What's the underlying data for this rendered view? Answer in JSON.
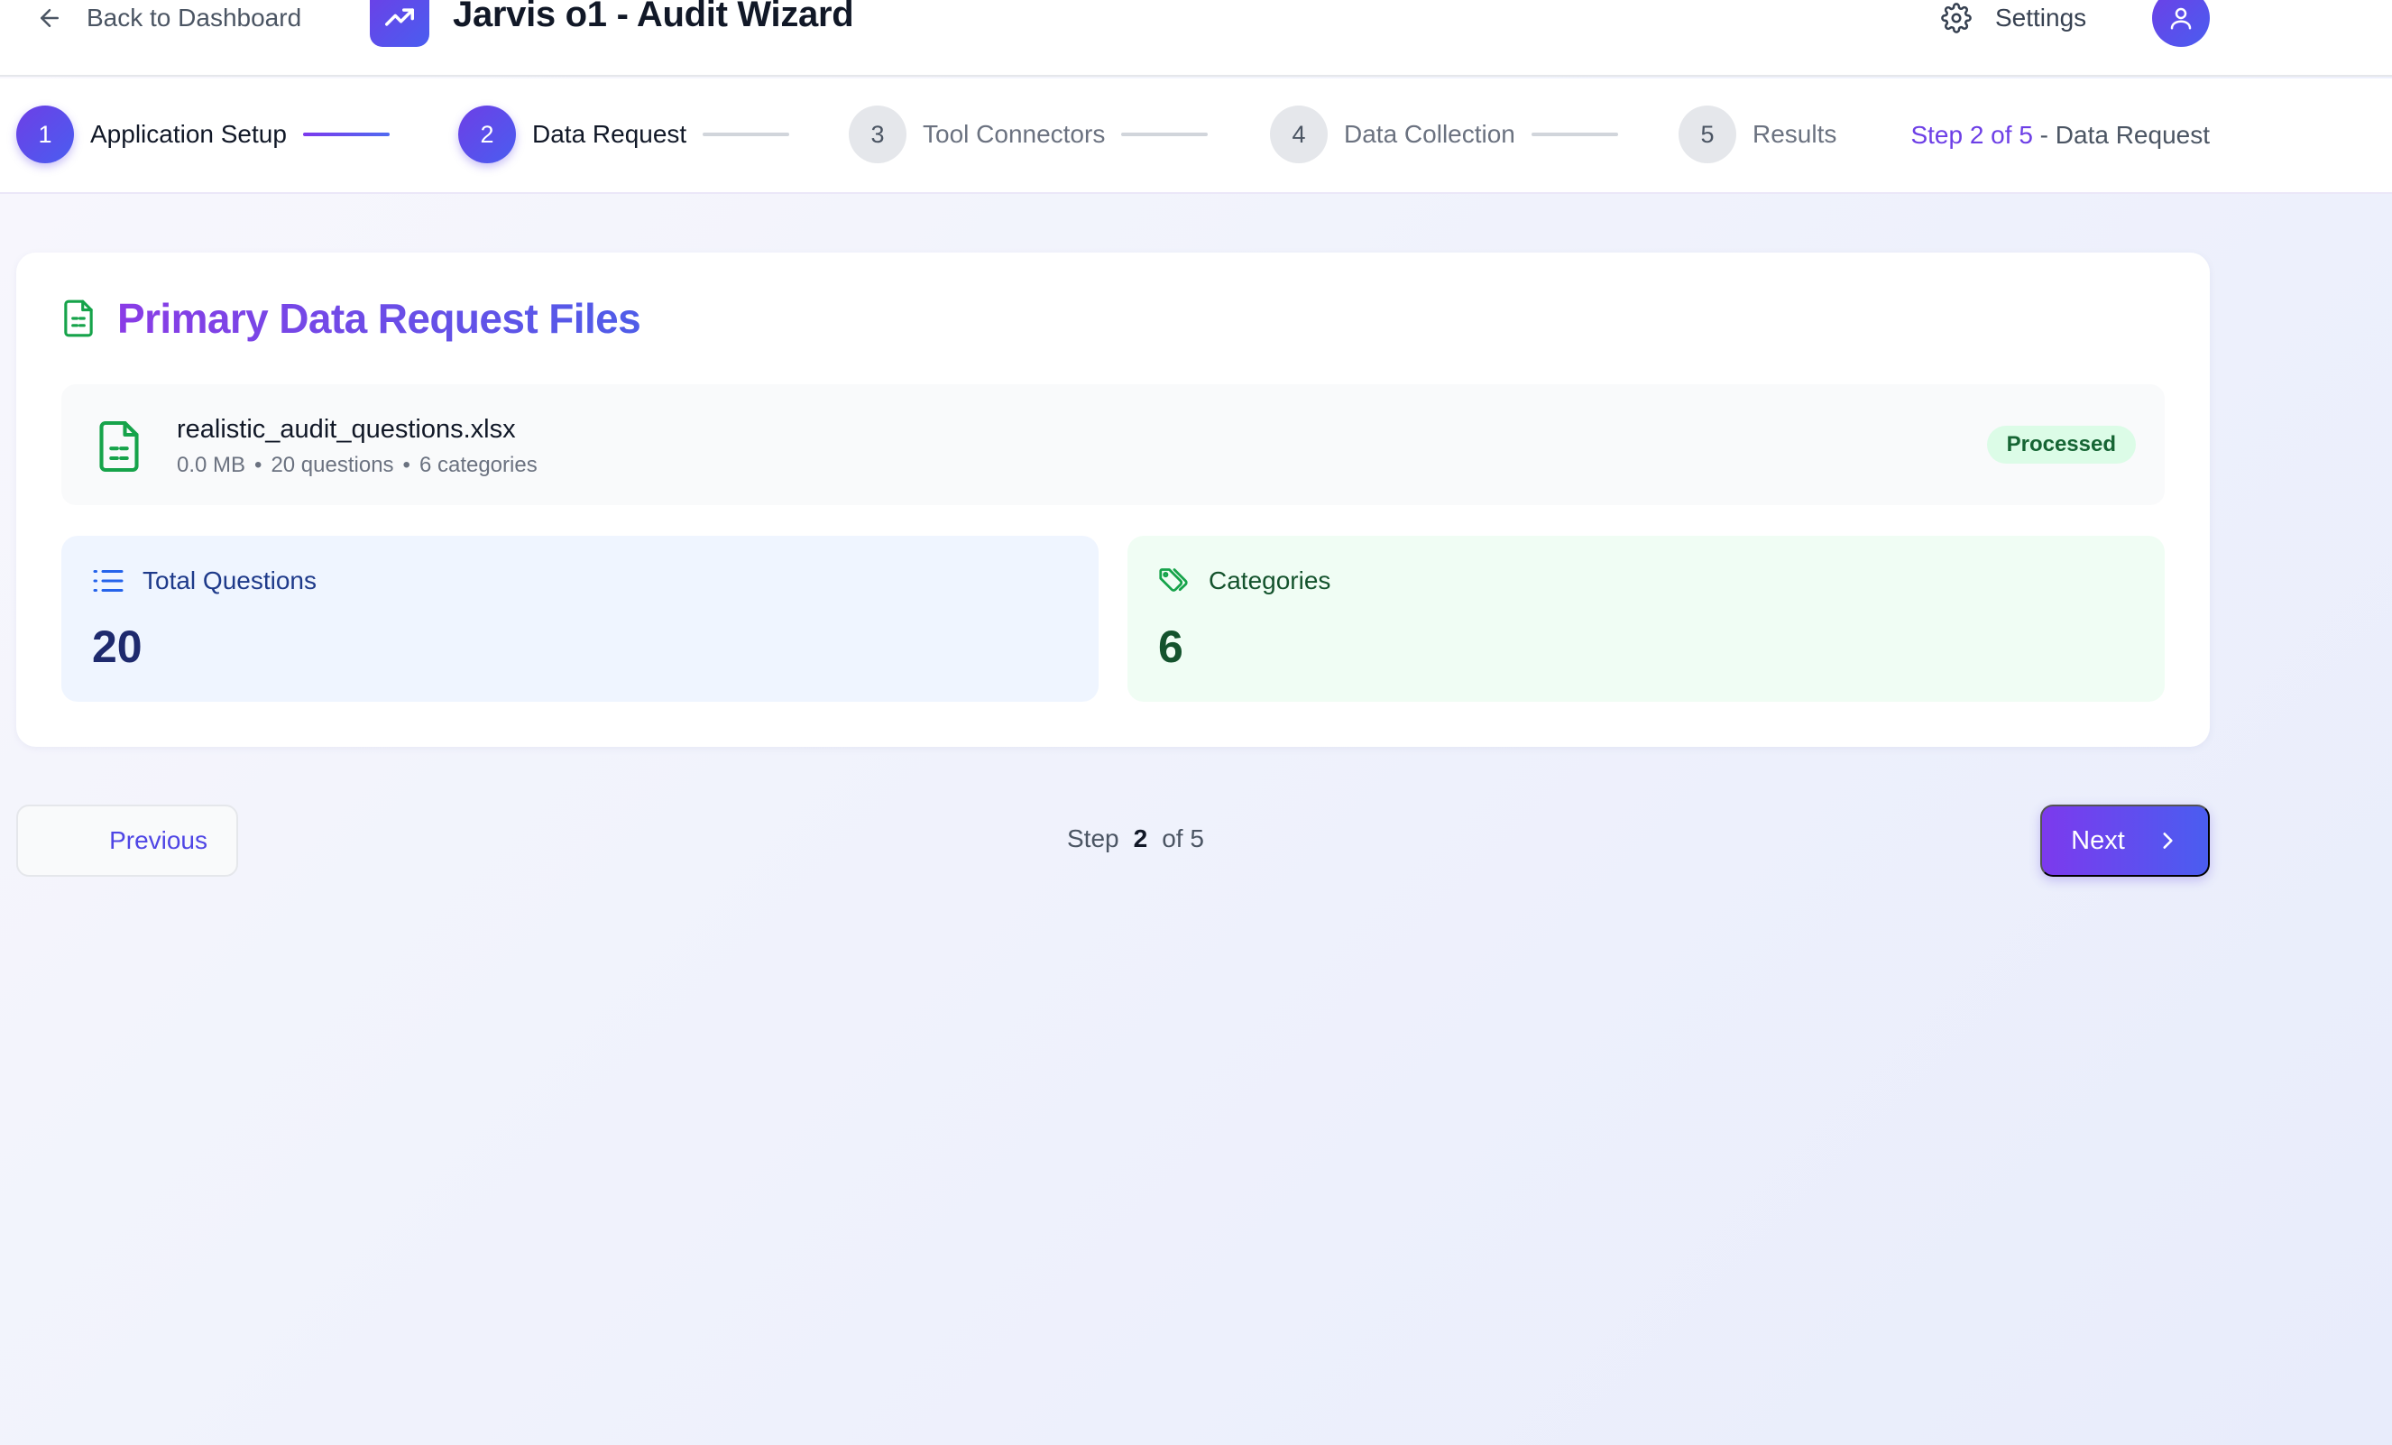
{
  "header": {
    "back_label": "Back to Dashboard",
    "title": "Jarvis o1 - Audit Wizard",
    "settings_label": "Settings"
  },
  "stepper": {
    "steps": [
      {
        "number": "1",
        "label": "Application Setup",
        "state": "completed"
      },
      {
        "number": "2",
        "label": "Data Request",
        "state": "current"
      },
      {
        "number": "3",
        "label": "Tool Connectors",
        "state": "upcoming"
      },
      {
        "number": "4",
        "label": "Data Collection",
        "state": "upcoming"
      },
      {
        "number": "5",
        "label": "Results",
        "state": "upcoming"
      }
    ],
    "status_accent": "Step 2 of 5",
    "status_rest": " - Data Request"
  },
  "card": {
    "title": "Primary Data Request Files",
    "file": {
      "name": "realistic_audit_questions.xlsx",
      "size": "0.0 MB",
      "questions": "20 questions",
      "categories": "6 categories",
      "separator": "•",
      "status": "Processed"
    },
    "stats": {
      "total_questions_label": "Total Questions",
      "total_questions_value": "20",
      "categories_label": "Categories",
      "categories_value": "6"
    }
  },
  "footer": {
    "previous_label": "Previous",
    "step_word": "Step",
    "step_current": "2",
    "step_total": "of 5",
    "next_label": "Next"
  },
  "colors": {
    "brand_purple": "#6d3fe6",
    "brand_blue": "#4a5df0",
    "success_green": "#16a34a",
    "success_bg": "#dcfce7"
  },
  "icons": {
    "back": "arrow-left-icon",
    "logo": "trending-up-icon",
    "settings": "gear-icon",
    "avatar": "user-icon",
    "card": "file-spreadsheet-icon",
    "total_questions": "list-icon",
    "categories": "tags-icon",
    "next": "chevron-right-icon"
  }
}
